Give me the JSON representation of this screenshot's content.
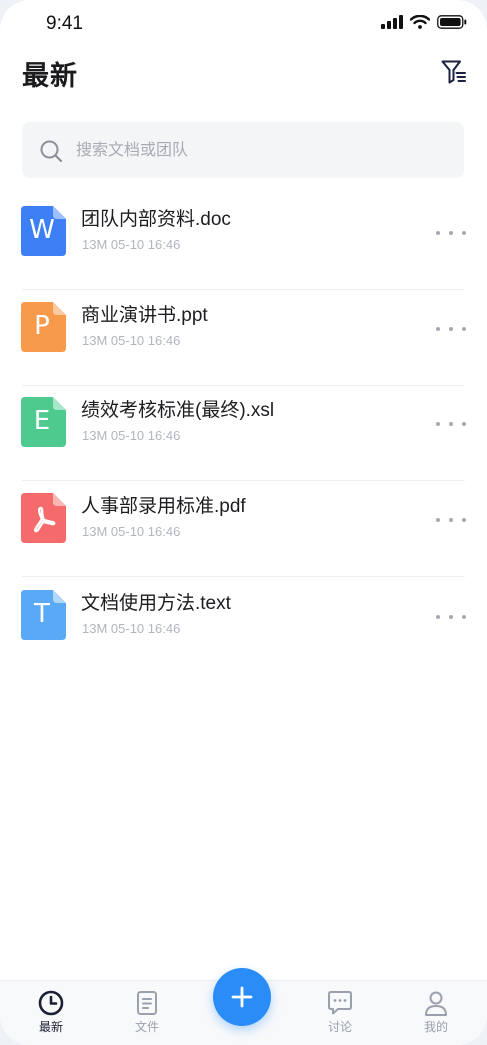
{
  "status_bar": {
    "time": "9:41"
  },
  "header": {
    "title": "最新"
  },
  "search": {
    "placeholder": "搜索文档或团队"
  },
  "files": [
    {
      "letter": "W",
      "name": "团队内部资料.doc",
      "meta": "13M 05-10 16:46",
      "color": "#3d7ff4"
    },
    {
      "letter": "P",
      "name": "商业演讲书.ppt",
      "meta": "13M 05-10 16:46",
      "color": "#f89a4c"
    },
    {
      "letter": "E",
      "name": "绩效考核标准(最终).xsl",
      "meta": "13M 05-10 16:46",
      "color": "#4fca8f"
    },
    {
      "letter": "",
      "name": "人事部录用标准.pdf",
      "meta": "13M 05-10 16:46",
      "color": "#f56b6b",
      "icon": "acrobat-icon"
    },
    {
      "letter": "T",
      "name": "文档使用方法.text",
      "meta": "13M 05-10 16:46",
      "color": "#5aa9f7"
    }
  ],
  "tabbar": {
    "tabs": [
      {
        "label": "最新",
        "icon": "clock-icon",
        "active": true
      },
      {
        "label": "文件",
        "icon": "document-icon",
        "active": false
      },
      {
        "label": "讨论",
        "icon": "chat-icon",
        "active": false
      },
      {
        "label": "我的",
        "icon": "user-icon",
        "active": false
      }
    ],
    "fab_icon": "plus-icon"
  },
  "colors": {
    "accent": "#2a8cf6",
    "text": "#1d1d22",
    "muted": "#b1b5bd"
  }
}
